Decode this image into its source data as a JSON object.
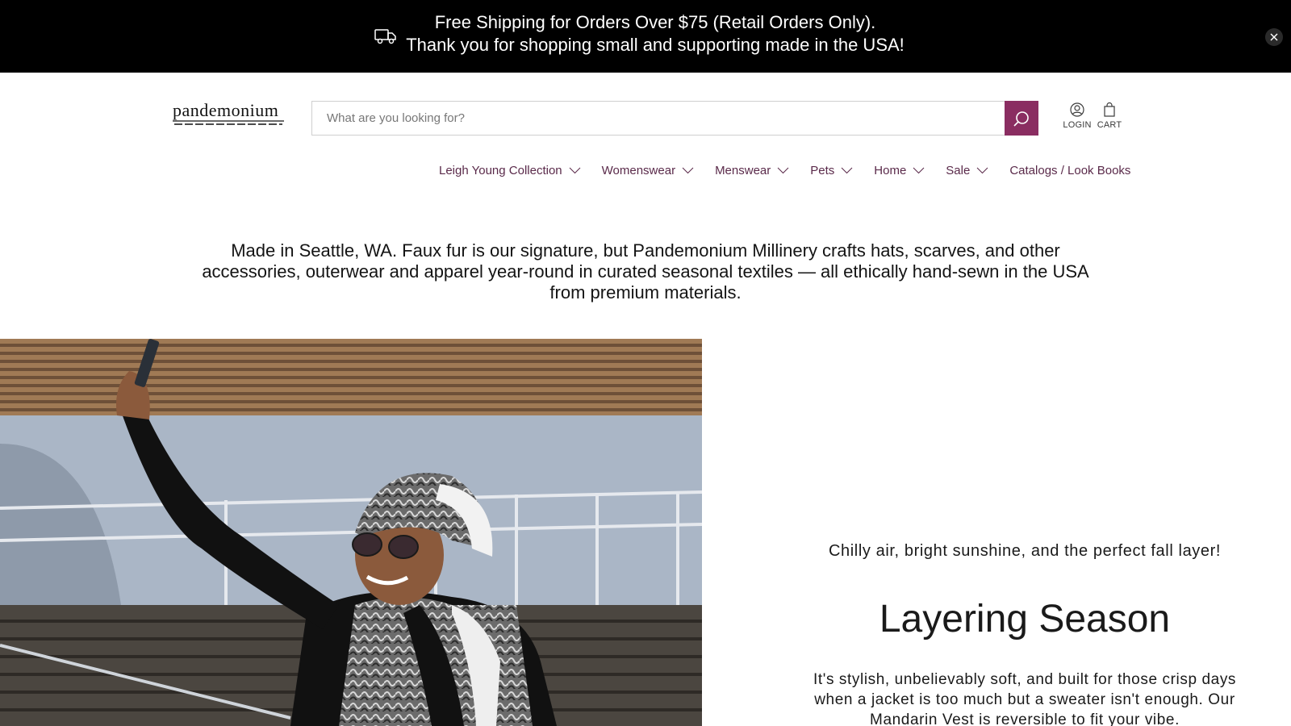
{
  "announcement": {
    "line1": "Free Shipping for Orders Over $75 (Retail Orders Only).",
    "line2": "Thank you for shopping small and supporting made in the USA!",
    "icon": "truck-icon",
    "close_icon": "close-icon"
  },
  "header": {
    "logo_icon": "pandemonium-logo",
    "search": {
      "placeholder": "What are you looking for?",
      "value": "",
      "button_icon": "search-icon"
    },
    "account": {
      "label": "LOGIN",
      "icon": "user-icon"
    },
    "cart": {
      "label": "CART",
      "icon": "bag-icon"
    }
  },
  "nav": {
    "items": [
      {
        "label": "Leigh Young Collection",
        "has_dropdown": true
      },
      {
        "label": "Womenswear",
        "has_dropdown": true
      },
      {
        "label": "Menswear",
        "has_dropdown": true
      },
      {
        "label": "Pets",
        "has_dropdown": true
      },
      {
        "label": "Home",
        "has_dropdown": true
      },
      {
        "label": "Sale",
        "has_dropdown": true
      },
      {
        "label": "Catalogs / Look Books",
        "has_dropdown": false
      }
    ]
  },
  "intro": {
    "text": "Made in Seattle, WA. Faux fur is our signature, but Pandemonium Millinery crafts hats, scarves, and other accessories, outerwear and apparel year-round in curated seasonal textiles — all ethically hand-sewn in the USA from premium materials."
  },
  "hero": {
    "eyebrow": "Chilly air, bright sunshine, and the perfect fall layer!",
    "title": "Layering Season",
    "body": "It's stylish, unbelievably soft, and built for those crisp days when a jacket is too much but a sweater isn't enough. Our Mandarin Vest is reversible to fit your vibe."
  },
  "colors": {
    "brand": "#8a2d61",
    "nav_text": "#5a2a4a",
    "announce_bg": "#000000"
  }
}
